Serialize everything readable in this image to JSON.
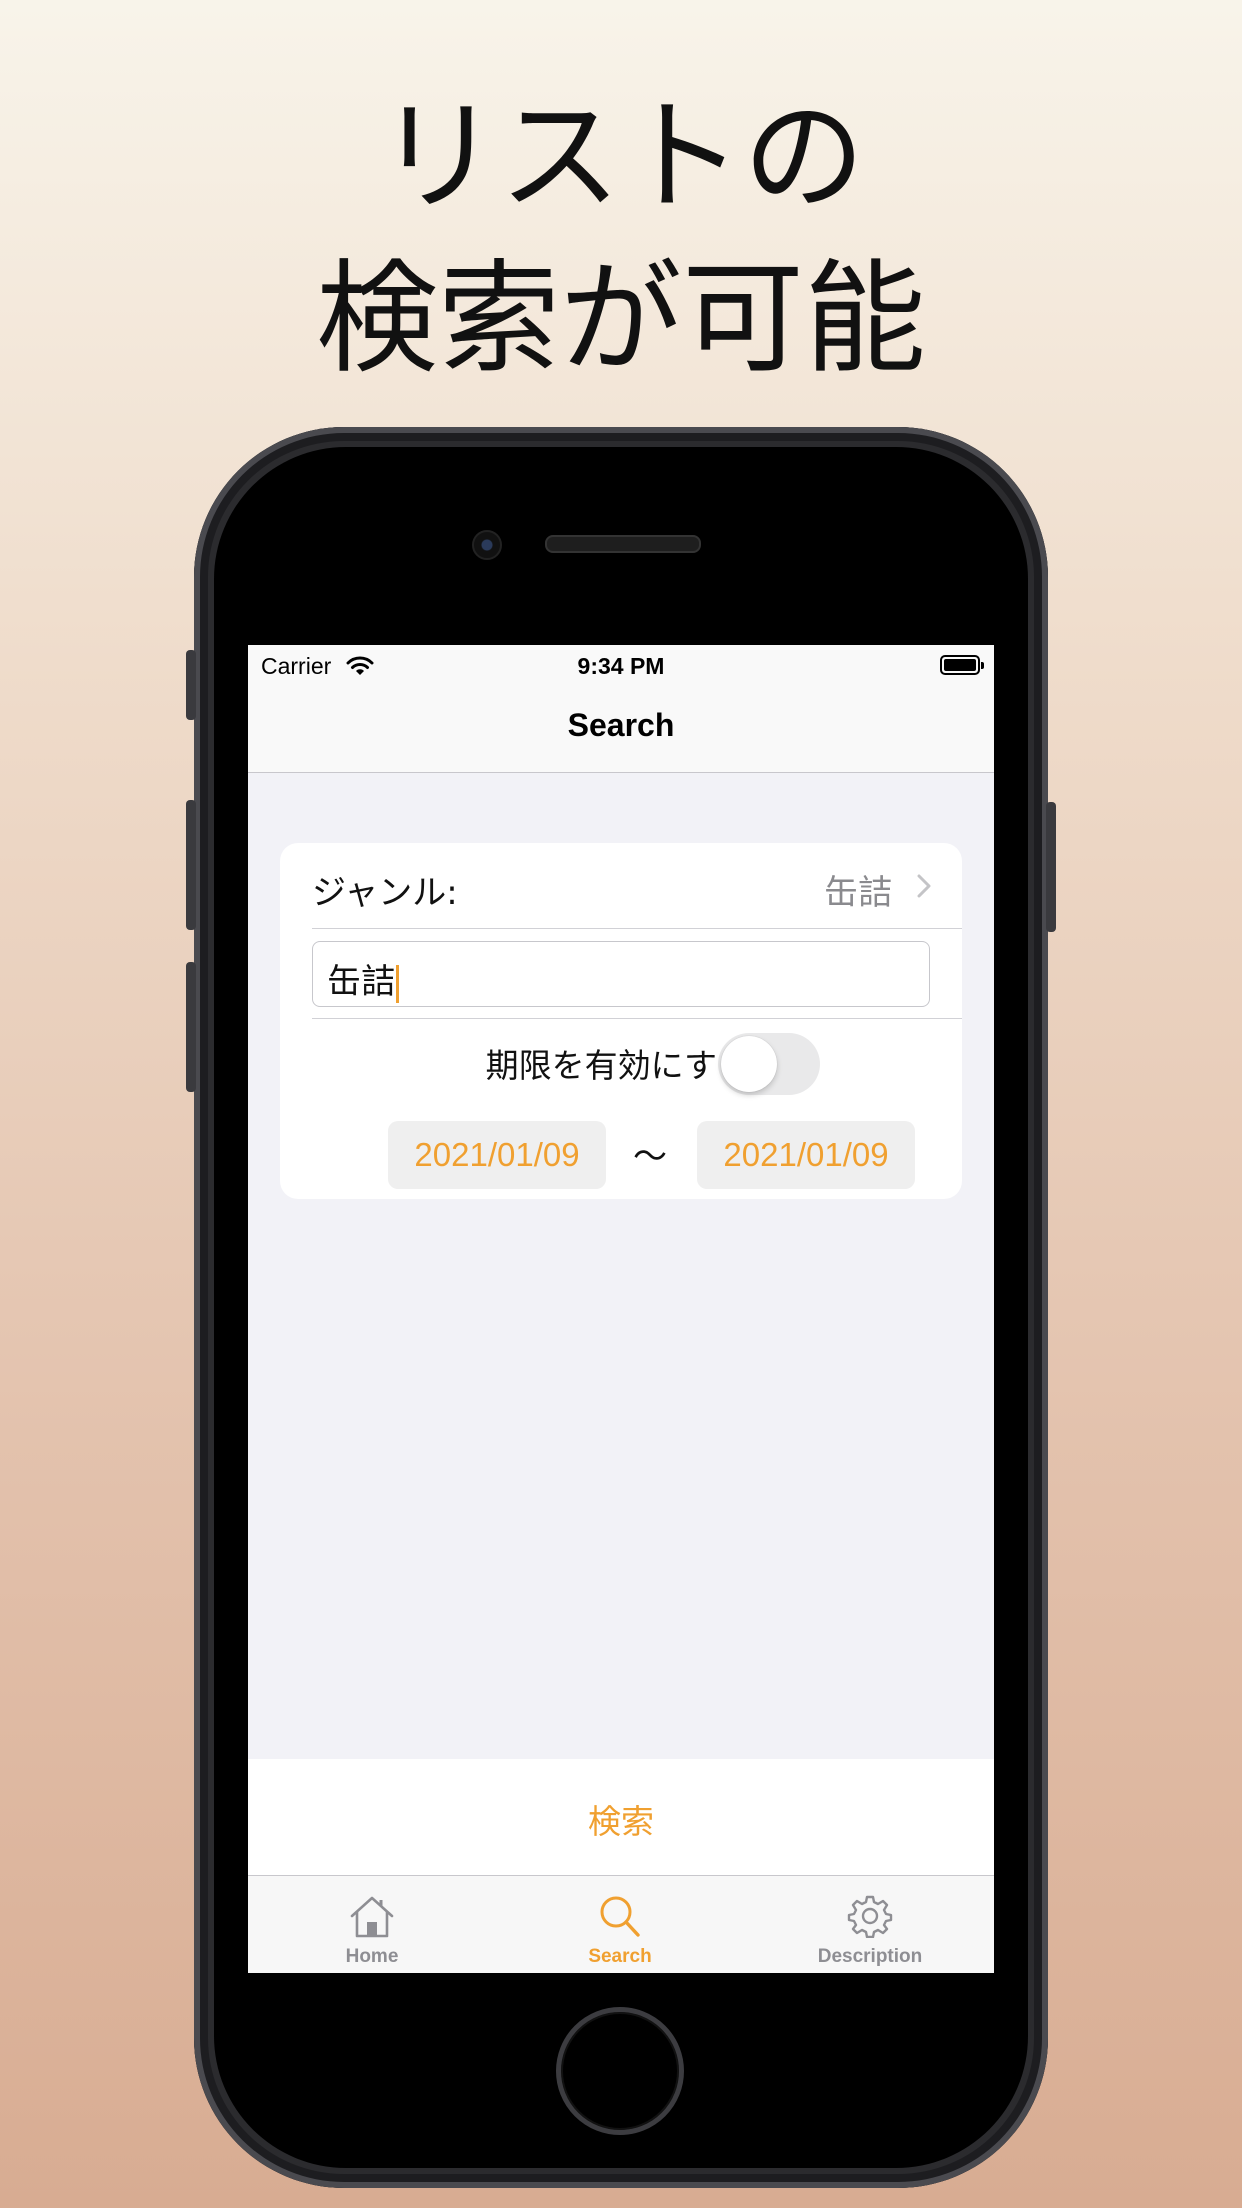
{
  "headline": {
    "line1": "リストの",
    "line2": "検索が可能"
  },
  "status_bar": {
    "carrier": "Carrier",
    "time": "9:34 PM"
  },
  "nav": {
    "title": "Search"
  },
  "form": {
    "genre_label": "ジャンル:",
    "genre_value": "缶詰",
    "search_text": "缶詰",
    "expiry_toggle_label": "期限を有効にする",
    "expiry_toggle_on": false,
    "date_from": "2021/01/09",
    "date_separator": "〜",
    "date_to": "2021/01/09"
  },
  "search_button": {
    "label": "検索"
  },
  "tabs": [
    {
      "label": "Home",
      "icon": "house-icon",
      "active": false
    },
    {
      "label": "Search",
      "icon": "magnifier-icon",
      "active": true
    },
    {
      "label": "Description",
      "icon": "gear-icon",
      "active": false
    }
  ],
  "colors": {
    "accent": "#f0a030",
    "background": "#f2f2f7"
  }
}
